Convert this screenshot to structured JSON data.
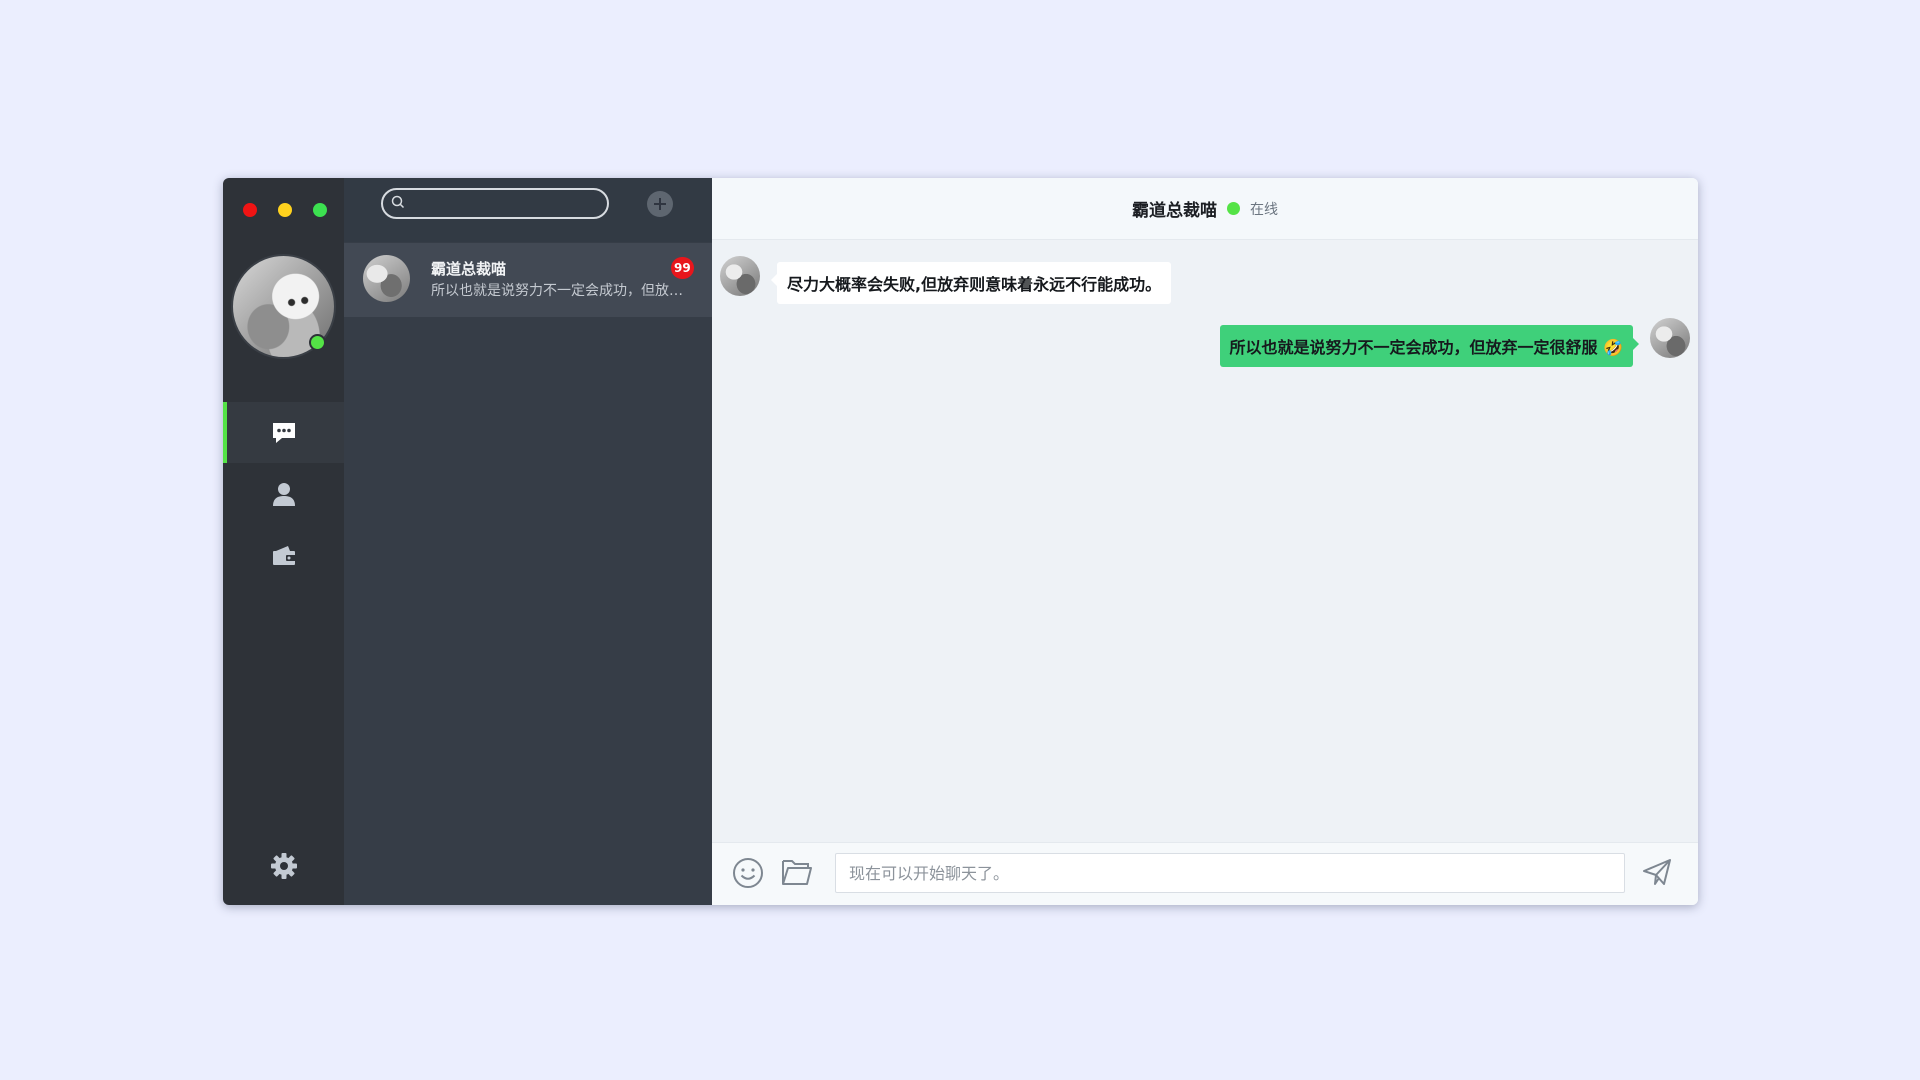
{
  "sidebar": {
    "nav_items": [
      {
        "name": "chat",
        "icon": "chat-bubble-icon",
        "active": true
      },
      {
        "name": "contacts",
        "icon": "person-icon",
        "active": false
      },
      {
        "name": "wallet",
        "icon": "wallet-icon",
        "active": false
      }
    ],
    "settings_icon": "gear-icon",
    "online_status_color": "#54e346",
    "accent_color": "#54e346"
  },
  "session_list": {
    "search": {
      "placeholder": "",
      "value": ""
    },
    "add_icon": "plus-icon",
    "sessions": [
      {
        "name": "霸道总裁喵",
        "preview": "所以也就是说努力不一定会成功，但放弃一定很舒服",
        "unread": "99",
        "selected": true
      }
    ]
  },
  "chat": {
    "title": "霸道总裁喵",
    "status": "在线",
    "messages": [
      {
        "from": "other",
        "text": "尽力大概率会失败,但放弃则意味着永远不行能成功。"
      },
      {
        "from": "me",
        "text": "所以也就是说努力不一定会成功，但放弃一定很舒服 🤣"
      }
    ],
    "input": {
      "placeholder": "现在可以开始聊天了。",
      "value": ""
    },
    "footer_icons": [
      "smiley-icon",
      "folder-icon",
      "send-icon"
    ],
    "bubble_colors": {
      "me": "#3fd07a",
      "other": "#ffffff"
    }
  }
}
